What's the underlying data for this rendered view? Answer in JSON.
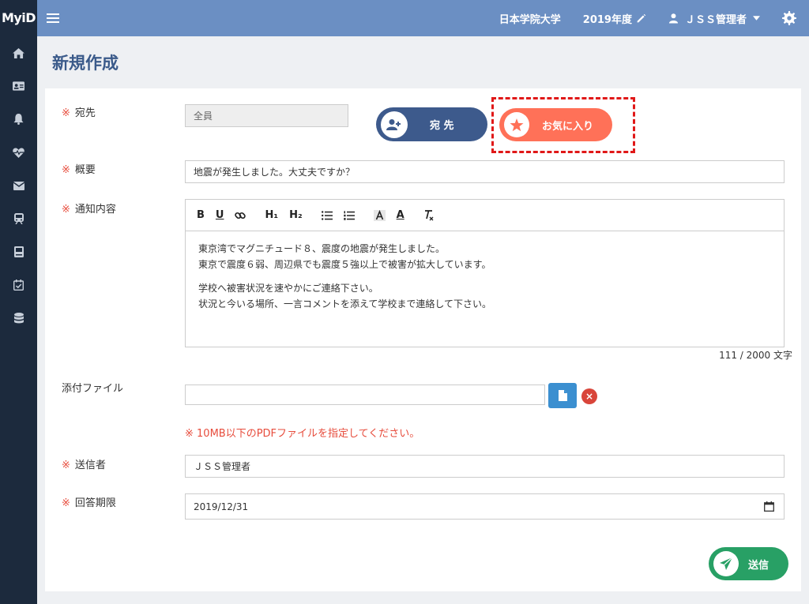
{
  "header": {
    "brand": "MyiD",
    "university": "日本学院大学",
    "year": "2019年度",
    "user": "ＪＳＳ管理者"
  },
  "sidebar": {
    "icons": [
      "home-icon",
      "id-card-icon",
      "bell-icon",
      "heartbeat-icon",
      "mail-icon",
      "train-icon",
      "book-icon",
      "calendar-check-icon",
      "database-icon"
    ]
  },
  "page": {
    "title": "新規作成"
  },
  "form": {
    "required_mark": "※",
    "recipient": {
      "label": "宛先",
      "value": "全員",
      "add_button": "宛 先",
      "favorite_button": "お気に入り"
    },
    "summary": {
      "label": "概要",
      "value": "地震が発生しました。大丈夫ですか？"
    },
    "content": {
      "label": "通知内容",
      "toolbar": [
        "B",
        "U",
        "H₁",
        "H₂",
        "A"
      ],
      "lines": [
        "東京湾でマグニチュード８、震度の地震が発生しました。",
        "東京で震度６弱、周辺県でも震度５強以上で被害が拡大しています。",
        "",
        "学校へ被害状況を速やかにご連絡下さい。",
        "状況と今いる場所、一言コメントを添えて学校まで連絡して下さい。"
      ],
      "counter": "111 / 2000 文字"
    },
    "attachment": {
      "label": "添付ファイル",
      "value": "",
      "delete_label": "×",
      "note": "※ 10MB以下のPDFファイルを指定してください。"
    },
    "sender": {
      "label": "送信者",
      "value": "ＪＳＳ管理者"
    },
    "deadline": {
      "label": "回答期限",
      "value": "2019/12/31"
    },
    "send_button": "送信"
  },
  "colors": {
    "topbar": "#6b8fc3",
    "sidebar": "#1c2a3d",
    "accent_blue": "#3d5a8c",
    "favorite": "#ff7158",
    "send": "#28a065",
    "required": "#e74c3c",
    "highlight": "#e01818"
  }
}
